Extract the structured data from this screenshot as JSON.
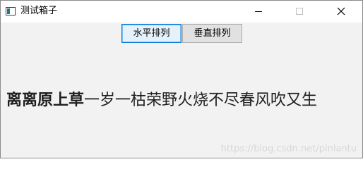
{
  "window": {
    "title": "测试箱子"
  },
  "icons": {
    "app": "window-app-icon",
    "minimize": "minimize-icon",
    "maximize": "maximize-icon",
    "close": "close-icon"
  },
  "toolbar": {
    "horizontal_label": "水平排列",
    "vertical_label": "垂直排列"
  },
  "poem": {
    "bold_part": "离离原上草",
    "regular_part": "一岁一枯荣野火烧不尽春风吹又生"
  },
  "watermark": {
    "text": "https://blog.csdn.net/pinlantu"
  }
}
